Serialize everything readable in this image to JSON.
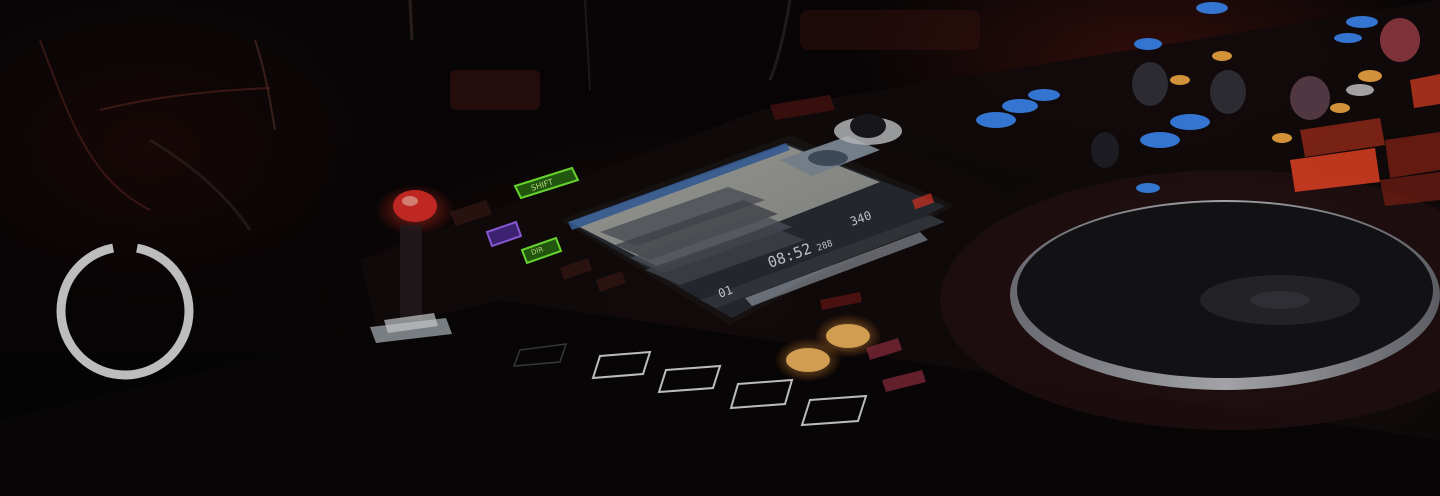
{
  "player": {
    "screen": {
      "time": "08:52",
      "time_ms": "288",
      "bpm": "340",
      "track": "01"
    },
    "buttons": {
      "top_green": "SHIFT",
      "bottom_green": "DIR"
    }
  },
  "loader": {
    "state": "loading",
    "arc_color": "#bdbdbd",
    "progress": 0.94
  },
  "colors": {
    "accent_blue": "#3f8fff",
    "accent_red": "#ff3a2a",
    "accent_green": "#7dff3a",
    "accent_orange": "#ffb347"
  }
}
